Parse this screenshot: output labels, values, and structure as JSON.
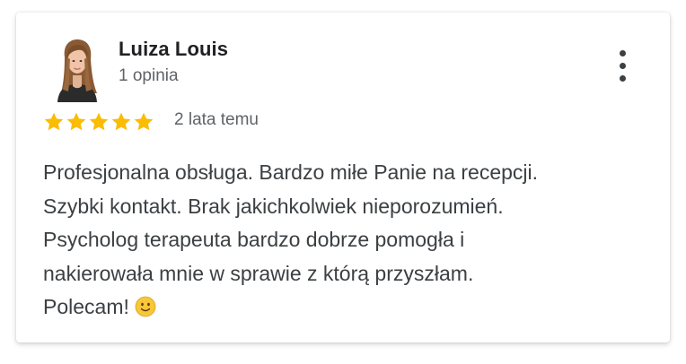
{
  "reviewer": {
    "name": "Luiza Louis",
    "review_count": "1 opinia"
  },
  "rating": {
    "stars": 5,
    "max": 5,
    "time_ago": "2 lata temu",
    "star_color": "#fbbc04"
  },
  "review": {
    "lines": [
      "Profesjonalna obsługa. Bardzo miłe Panie na recepcji.",
      "Szybki kontakt. Brak jakichkolwiek nieporozumień.",
      "Psycholog terapeuta bardzo dobrze pomogła i",
      "nakierowała mnie w sprawie z którą przyszłam.",
      "Polecam!"
    ],
    "emoji": "slightly-smiling-face-icon"
  },
  "menu": {
    "icon": "more-vert-icon"
  }
}
